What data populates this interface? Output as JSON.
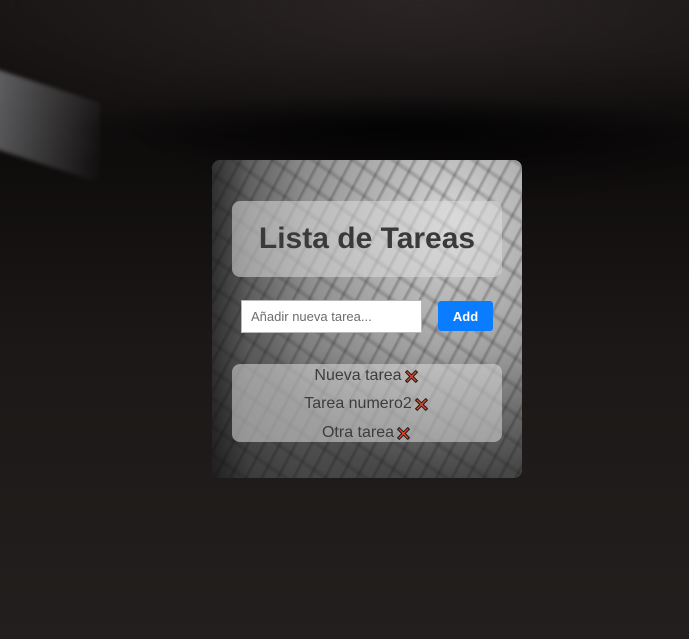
{
  "app": {
    "title": "Lista de Tareas"
  },
  "form": {
    "input_value": "",
    "input_placeholder": "Añadir nueva tarea...",
    "add_label": "Add"
  },
  "tasks": [
    {
      "label": "Nueva tarea",
      "icon": "delete-x-icon"
    },
    {
      "label": "Tarea numero2",
      "icon": "delete-x-icon"
    },
    {
      "label": "Otra tarea",
      "icon": "delete-x-icon"
    }
  ],
  "colors": {
    "accent": "#0a7cff",
    "delete_icon": "#e0452a"
  }
}
